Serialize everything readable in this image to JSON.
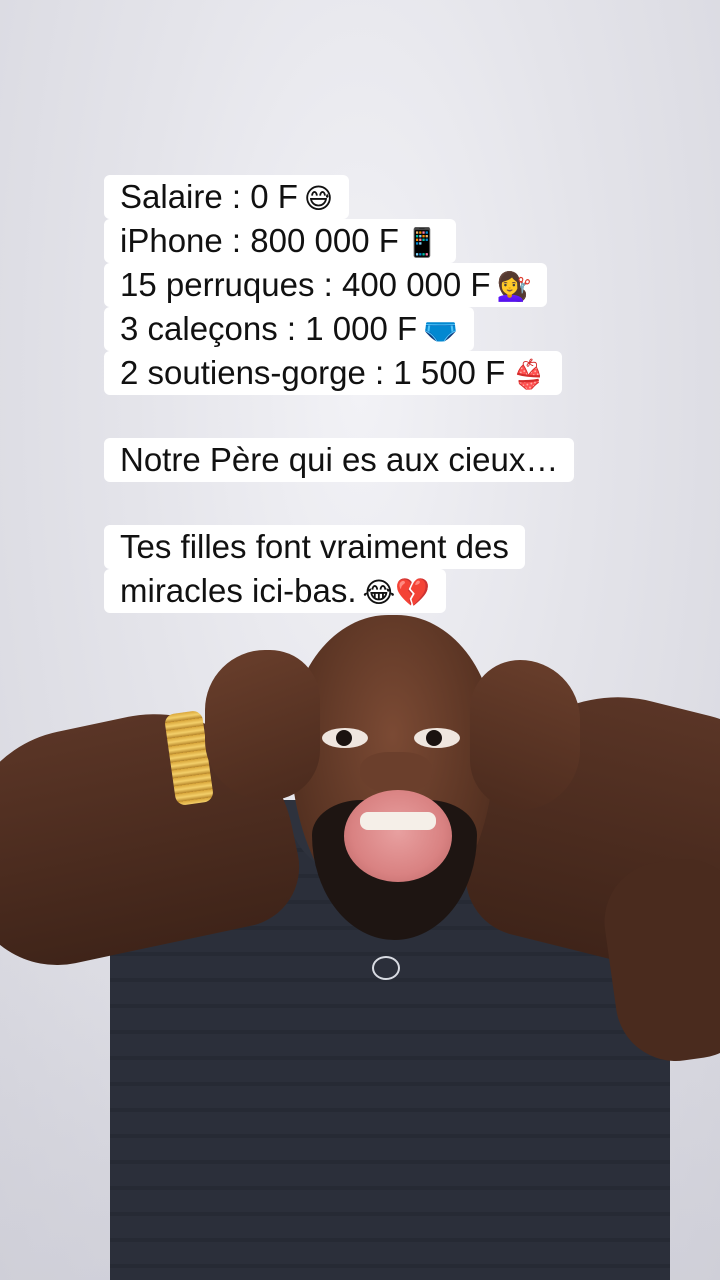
{
  "caption": {
    "block1": [
      {
        "text": "Salaire : 0 F",
        "emoji": "😅"
      },
      {
        "text": "iPhone : 800 000 F",
        "emoji": "📱"
      },
      {
        "text": "15 perruques : 400 000 F",
        "emoji": "💇‍♀️"
      },
      {
        "text": "3 caleçons : 1 000 F",
        "emoji": "🩲"
      },
      {
        "text": "2 soutiens-gorge : 1 500 F",
        "emoji": "👙"
      }
    ],
    "block2": [
      {
        "text": "Notre Père qui es aux cieux…",
        "emoji": ""
      }
    ],
    "block3": [
      {
        "text": "Tes filles font vraiment des",
        "emoji": ""
      },
      {
        "text": "miracles ici-bas.",
        "emoji": "😂💔"
      }
    ]
  }
}
